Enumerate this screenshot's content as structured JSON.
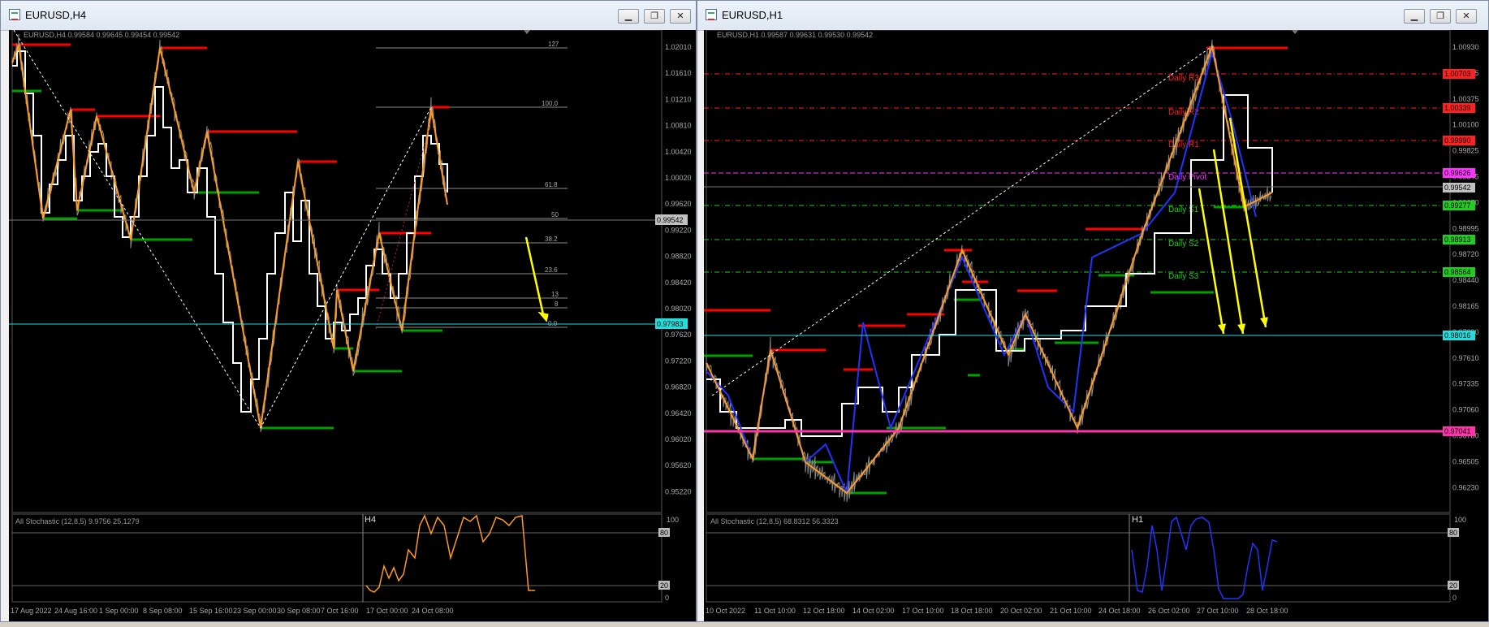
{
  "colors": {
    "bg": "#000000",
    "price": "#9a9a9a",
    "white_line": "#ffffff",
    "zigzag": "#ff9a22",
    "zigzag_blue": "#2233ff",
    "resistance": "#ff0000",
    "support": "#00a000",
    "cyan": "#22dddd",
    "magenta": "#ff33cc",
    "arrow": "#ffff00",
    "fib": "#8c8c8c"
  },
  "windows": [
    {
      "id": "h4",
      "title": "EURUSD,H4",
      "header": "EURUSD,H4  0.99584 0.99645 0.99454 0.99542",
      "price_axis": {
        "labels": [
          "1.02010",
          "1.01610",
          "1.01210",
          "1.00810",
          "1.00420",
          "1.00020",
          "0.99620",
          "0.99220",
          "0.98820",
          "0.98420",
          "0.98020",
          "0.97620",
          "0.97220",
          "0.96820",
          "0.96420",
          "0.96020",
          "0.95620",
          "0.95220"
        ],
        "current": "0.99542",
        "cyan": "0.97983"
      },
      "fib_labels": [
        "127",
        "100.0",
        "61.8",
        "50",
        "38.2",
        "23.6",
        "13",
        "8",
        "0.0"
      ],
      "time_axis": [
        "17 Aug 2022",
        "24 Aug 16:00",
        "1 Sep 00:00",
        "8 Sep 08:00",
        "15 Sep 16:00",
        "23 Sep 00:00",
        "30 Sep 08:00",
        "7 Oct 16:00",
        "17 Oct 00:00",
        "24 Oct 08:00"
      ],
      "stoch": {
        "header": "All Stochastic (12,8,5) 9.9756 25.1279",
        "tf": "H4",
        "levels": [
          "100",
          "80",
          "20",
          "0"
        ]
      }
    },
    {
      "id": "h1",
      "title": "EURUSD,H1",
      "header": "EURUSD,H1  0.99587 0.99631 0.99530 0.99542",
      "price_axis": {
        "labels": [
          "1.00930",
          "1.00655",
          "1.00375",
          "1.00100",
          "0.99825",
          "0.99545",
          "0.99270",
          "0.98995",
          "0.98720",
          "0.98440",
          "0.98165",
          "0.97890",
          "0.97610",
          "0.97335",
          "0.97060",
          "0.96780",
          "0.96505",
          "0.96230"
        ],
        "current": "0.99542",
        "cyan": "0.98016",
        "magenta_level": "0.97041"
      },
      "pivots": [
        {
          "name": "Daily R3",
          "value": "1.00703",
          "color": "#ff2020"
        },
        {
          "name": "Daily R2",
          "value": "1.00339",
          "color": "#ff2020"
        },
        {
          "name": "Daily R1",
          "value": "0.99990",
          "color": "#ff2020"
        },
        {
          "name": "Daily Pivot",
          "value": "0.99626",
          "color": "#ff33ff"
        },
        {
          "name": "Daily S1",
          "value": "0.99277",
          "color": "#22cc22"
        },
        {
          "name": "Daily S2",
          "value": "0.98913",
          "color": "#22cc22"
        },
        {
          "name": "Daily S3",
          "value": "0.98564",
          "color": "#22cc22"
        }
      ],
      "time_axis": [
        "10 Oct 2022",
        "11 Oct 10:00",
        "12 Oct 18:00",
        "14 Oct 02:00",
        "17 Oct 10:00",
        "18 Oct 18:00",
        "20 Oct 02:00",
        "21 Oct 10:00",
        "24 Oct 18:00",
        "26 Oct 02:00",
        "27 Oct 10:00",
        "28 Oct 18:00"
      ],
      "stoch": {
        "header": "All Stochastic (12,8,5) 68.8312 56.3323",
        "tf": "H1",
        "levels": [
          "100",
          "80",
          "20",
          "0"
        ]
      }
    }
  ],
  "window_buttons": [
    "minimize-icon",
    "restore-icon",
    "close-icon"
  ],
  "window_button_glyphs": [
    "▁",
    "❐",
    "✕"
  ]
}
